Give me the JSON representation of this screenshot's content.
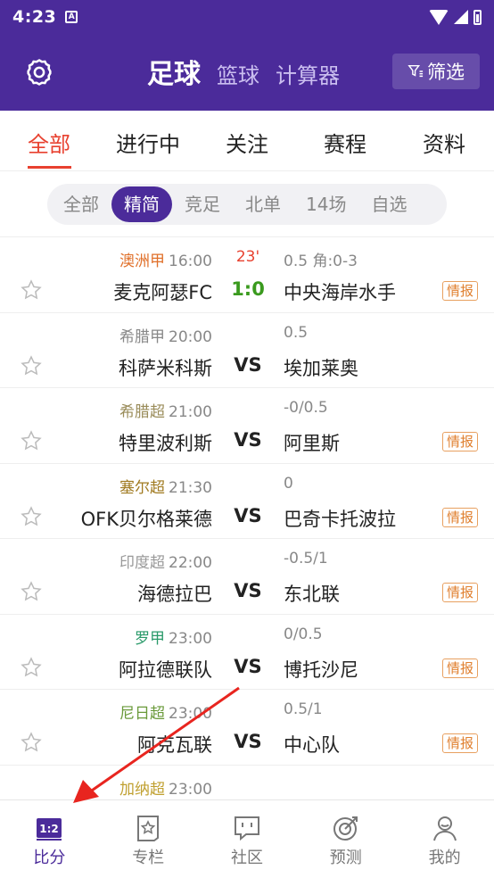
{
  "status_bar": {
    "time": "4:23",
    "notif_icon": "A"
  },
  "header": {
    "title_active": "足球",
    "title_basketball": "篮球",
    "title_calculator": "计算器",
    "filter_label": "筛选"
  },
  "tabs": [
    {
      "label": "全部",
      "active": true
    },
    {
      "label": "进行中"
    },
    {
      "label": "关注"
    },
    {
      "label": "赛程"
    },
    {
      "label": "资料"
    }
  ],
  "chips": [
    {
      "label": "全部"
    },
    {
      "label": "精简",
      "active": true
    },
    {
      "label": "竞足"
    },
    {
      "label": "北单"
    },
    {
      "label": "14场"
    },
    {
      "label": "自选"
    }
  ],
  "matches": [
    {
      "league": "澳洲甲",
      "league_color": "#e0702a",
      "time": "16:00",
      "minute": "23'",
      "odds": "0.5    角:0-3",
      "home": "麦克阿瑟FC",
      "score": "1:0",
      "live": true,
      "away": "中央海岸水手",
      "intel": "情报"
    },
    {
      "league": "希腊甲",
      "league_color": "#888888",
      "time": "20:00",
      "minute": "",
      "odds": "0.5",
      "home": "科萨米科斯",
      "score": "VS",
      "live": false,
      "away": "埃加莱奥",
      "intel": ""
    },
    {
      "league": "希腊超",
      "league_color": "#9a8c5a",
      "time": "21:00",
      "minute": "",
      "odds": "-0/0.5",
      "home": "特里波利斯",
      "score": "VS",
      "live": false,
      "away": "阿里斯",
      "intel": "情报"
    },
    {
      "league": "塞尔超",
      "league_color": "#a07a20",
      "time": "21:30",
      "minute": "",
      "odds": "0",
      "home": "OFK贝尔格莱德",
      "score": "VS",
      "live": false,
      "away": "巴奇卡托波拉",
      "intel": "情报"
    },
    {
      "league": "印度超",
      "league_color": "#999999",
      "time": "22:00",
      "minute": "",
      "odds": "-0.5/1",
      "home": "海德拉巴",
      "score": "VS",
      "live": false,
      "away": "东北联",
      "intel": "情报"
    },
    {
      "league": "罗甲",
      "league_color": "#2a9a6a",
      "time": "23:00",
      "minute": "",
      "odds": "0/0.5",
      "home": "阿拉德联队",
      "score": "VS",
      "live": false,
      "away": "博托沙尼",
      "intel": "情报"
    },
    {
      "league": "尼日超",
      "league_color": "#6a9a3a",
      "time": "23:00",
      "minute": "",
      "odds": "0.5/1",
      "home": "阿克瓦联",
      "score": "VS",
      "live": false,
      "away": "中心队",
      "intel": "情报"
    },
    {
      "league": "加纳超",
      "league_color": "#c0a030",
      "time": "23:00",
      "minute": "",
      "odds": "",
      "home": "",
      "score": "",
      "live": false,
      "away": "",
      "intel": ""
    }
  ],
  "bottom_nav": [
    {
      "label": "比分",
      "icon": "score-board-icon",
      "active": true
    },
    {
      "label": "专栏",
      "icon": "column-star-icon"
    },
    {
      "label": "社区",
      "icon": "community-chat-icon"
    },
    {
      "label": "预测",
      "icon": "prediction-target-icon"
    },
    {
      "label": "我的",
      "icon": "profile-person-icon"
    }
  ],
  "colors": {
    "brand": "#4b2b9a",
    "accent": "#e8412f",
    "live_score": "#3a9a1e",
    "intel": "#e08030",
    "annotation_arrow": "#e8251f"
  }
}
